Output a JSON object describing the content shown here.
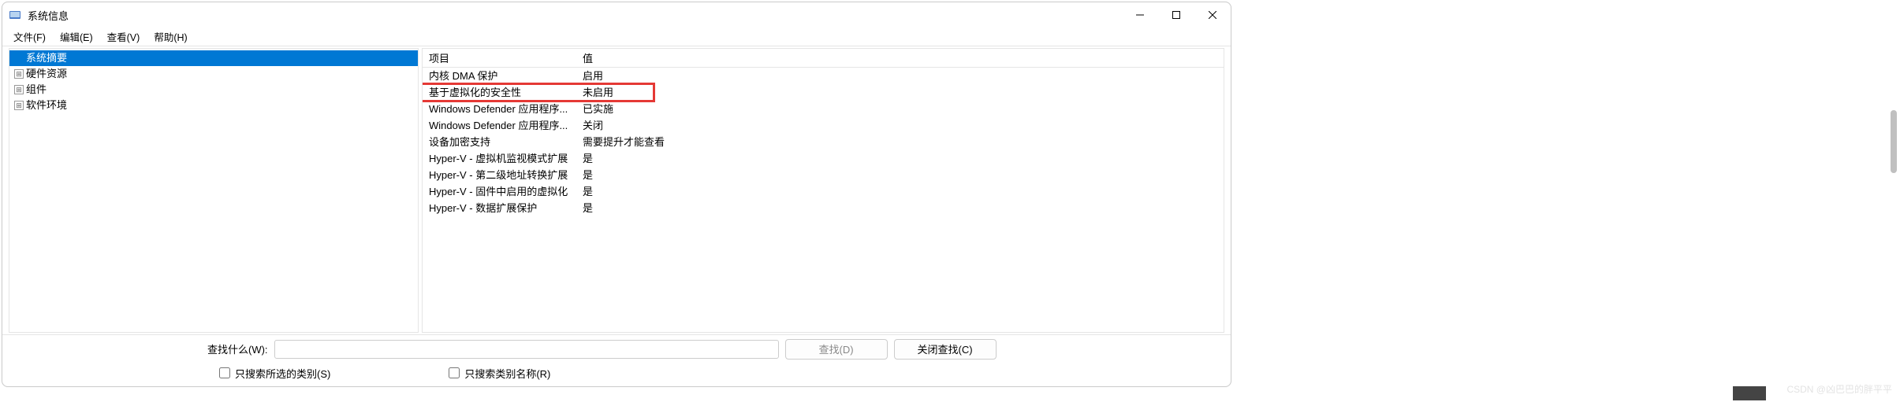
{
  "window": {
    "title": "系统信息"
  },
  "menubar": {
    "file": "文件(F)",
    "edit": "编辑(E)",
    "view": "查看(V)",
    "help": "帮助(H)"
  },
  "tree": {
    "items": [
      {
        "label": "系统摘要",
        "selected": true,
        "expandable": false
      },
      {
        "label": "硬件资源",
        "selected": false,
        "expandable": true
      },
      {
        "label": "组件",
        "selected": false,
        "expandable": true
      },
      {
        "label": "软件环境",
        "selected": false,
        "expandable": true
      }
    ]
  },
  "detail": {
    "headers": {
      "item": "项目",
      "value": "值"
    },
    "rows": [
      {
        "item": "内核 DMA 保护",
        "value": "启用"
      },
      {
        "item": "基于虚拟化的安全性",
        "value": "未启用",
        "highlighted": true
      },
      {
        "item": "Windows Defender 应用程序...",
        "value": "已实施"
      },
      {
        "item": "Windows Defender 应用程序...",
        "value": "关闭"
      },
      {
        "item": "设备加密支持",
        "value": "需要提升才能查看"
      },
      {
        "item": "Hyper-V - 虚拟机监视模式扩展",
        "value": "是"
      },
      {
        "item": "Hyper-V - 第二级地址转换扩展",
        "value": "是"
      },
      {
        "item": "Hyper-V - 固件中启用的虚拟化",
        "value": "是"
      },
      {
        "item": "Hyper-V - 数据扩展保护",
        "value": "是"
      }
    ]
  },
  "search": {
    "label": "查找什么(W):",
    "placeholder": "",
    "find_btn": "查找(D)",
    "close_btn": "关闭查找(C)",
    "opt_selected_only": "只搜索所选的类别(S)",
    "opt_category_names": "只搜索类别名称(R)"
  },
  "watermark": "CSDN @凶巴巴的胖平平"
}
